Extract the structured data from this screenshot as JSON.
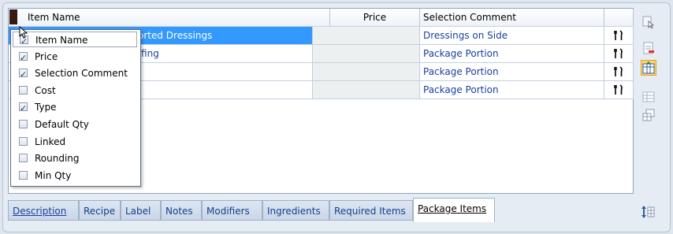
{
  "grid": {
    "headers": {
      "item_name": "Item Name",
      "price": "Price",
      "selection_comment": "Selection Comment",
      "type": ""
    },
    "rows": [
      {
        "item_name": "Assorted Dressings",
        "visible_name": "orted Dressings",
        "price": "",
        "selection_comment": "Dressings on Side",
        "type_icon": "fork-knife-icon",
        "type_glyph": "🍴",
        "selected": true
      },
      {
        "item_name": "Stuffing",
        "visible_name": "ffing",
        "price": "",
        "selection_comment": "Package Portion",
        "type_icon": "fork-knife-icon",
        "type_glyph": "🍴",
        "selected": false
      },
      {
        "item_name": "",
        "visible_name": "",
        "price": "",
        "selection_comment": "Package Portion",
        "type_icon": "fork-knife-icon",
        "type_glyph": "🍴",
        "selected": false
      },
      {
        "item_name": "",
        "visible_name": "",
        "price": "",
        "selection_comment": "Package Portion",
        "type_icon": "fork-knife-icon",
        "type_glyph": "🍴",
        "selected": false
      }
    ]
  },
  "column_menu": {
    "items": [
      {
        "label": "Item Name",
        "checked": true,
        "highlighted": true
      },
      {
        "label": "Price",
        "checked": true,
        "highlighted": false
      },
      {
        "label": "Selection Comment",
        "checked": true,
        "highlighted": false
      },
      {
        "label": "Cost",
        "checked": false,
        "highlighted": false
      },
      {
        "label": "Type",
        "checked": true,
        "highlighted": false
      },
      {
        "label": "Default Qty",
        "checked": false,
        "highlighted": false
      },
      {
        "label": "Linked",
        "checked": false,
        "highlighted": false
      },
      {
        "label": "Rounding",
        "checked": false,
        "highlighted": false
      },
      {
        "label": "Min Qty",
        "checked": false,
        "highlighted": false
      }
    ]
  },
  "tabs": [
    {
      "label": "Description",
      "active": false
    },
    {
      "label": "Recipe",
      "active": false
    },
    {
      "label": "Label",
      "active": false
    },
    {
      "label": "Notes",
      "active": false
    },
    {
      "label": "Modifiers",
      "active": false
    },
    {
      "label": "Ingredients",
      "active": false
    },
    {
      "label": "Required Items",
      "active": false
    },
    {
      "label": "Package Items",
      "active": true
    }
  ],
  "side_toolbar": {
    "buttons": [
      {
        "icon": "select-cursor-icon",
        "active": false
      },
      {
        "icon": "remove-item-icon",
        "active": false
      },
      {
        "icon": "fit-columns-icon",
        "active": true
      },
      {
        "icon": "grid-layout-icon",
        "active": false
      },
      {
        "icon": "grid-export-icon",
        "active": false
      }
    ],
    "bottom_icon": "sort-order-icon"
  },
  "colors": {
    "selected_row": "#3399ff",
    "link_text": "#1a3fa0",
    "active_toolbar": "#ffd36b"
  }
}
